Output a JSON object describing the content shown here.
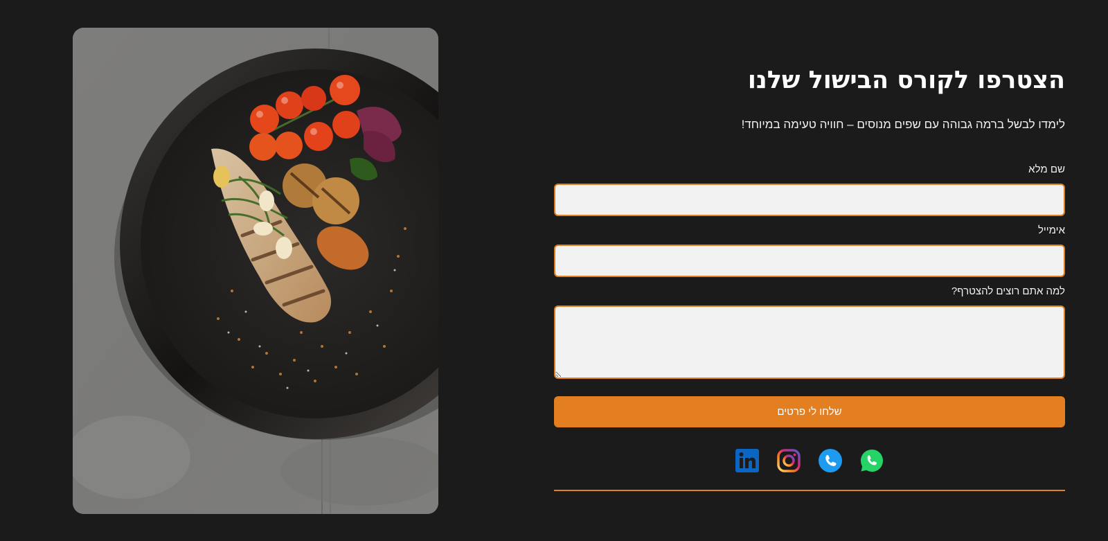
{
  "photo": {
    "icon": "grilled-fish-plate-photo"
  },
  "form": {
    "title": "הצטרפו לקורס הבישול שלנו",
    "subtitle": "לימדו לבשל ברמה גבוהה עם שפים מנוסים – חוויה טעימה במיוחד!",
    "fields": [
      {
        "label": "שם מלא",
        "value": "",
        "placeholder": ""
      },
      {
        "label": "אימייל",
        "value": "",
        "placeholder": ""
      },
      {
        "label": "למה אתם רוצים להצטרף?",
        "value": "",
        "placeholder": ""
      }
    ],
    "submit_label": "שלחו לי פרטים"
  },
  "social": [
    {
      "icon": "linkedin-icon",
      "color": "#0a66c2"
    },
    {
      "icon": "instagram-icon",
      "color": "#e1306c"
    },
    {
      "icon": "phone-icon",
      "color": "#1d9bf0"
    },
    {
      "icon": "whatsapp-icon",
      "color": "#25d366"
    }
  ],
  "colors": {
    "background": "#1b1b1b",
    "accent": "#e47f21",
    "input_bg": "#f2f2f2",
    "text": "#ffffff"
  }
}
